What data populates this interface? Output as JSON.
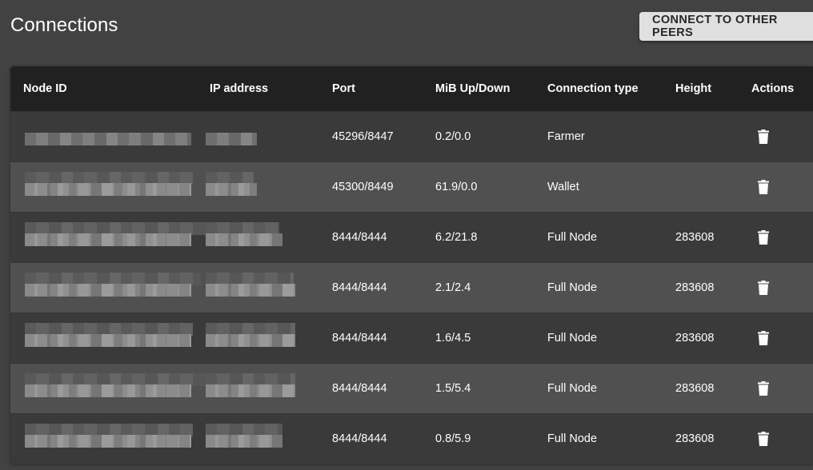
{
  "page": {
    "title": "Connections",
    "connect_button_label": "CONNECT TO OTHER PEERS"
  },
  "table": {
    "headers": {
      "node_id": "Node ID",
      "ip_address": "IP address",
      "port": "Port",
      "mib": "MiB Up/Down",
      "connection_type": "Connection type",
      "height": "Height",
      "actions": "Actions"
    },
    "rows": [
      {
        "port": "45296/8447",
        "mib": "0.2/0.0",
        "type": "Farmer",
        "height": ""
      },
      {
        "port": "45300/8449",
        "mib": "61.9/0.0",
        "type": "Wallet",
        "height": ""
      },
      {
        "port": "8444/8444",
        "mib": "6.2/21.8",
        "type": "Full Node",
        "height": "283608"
      },
      {
        "port": "8444/8444",
        "mib": "2.1/2.4",
        "type": "Full Node",
        "height": "283608"
      },
      {
        "port": "8444/8444",
        "mib": "1.6/4.5",
        "type": "Full Node",
        "height": "283608"
      },
      {
        "port": "8444/8444",
        "mib": "1.5/5.4",
        "type": "Full Node",
        "height": "283608"
      },
      {
        "port": "8444/8444",
        "mib": "0.8/5.9",
        "type": "Full Node",
        "height": "283608"
      }
    ]
  },
  "icons": {
    "delete": "trash-icon"
  },
  "colors": {
    "background": "#424242",
    "header": "#212121",
    "row_odd": "#3a3a3a",
    "row_even": "#505050",
    "button": "#e0e0e0"
  }
}
